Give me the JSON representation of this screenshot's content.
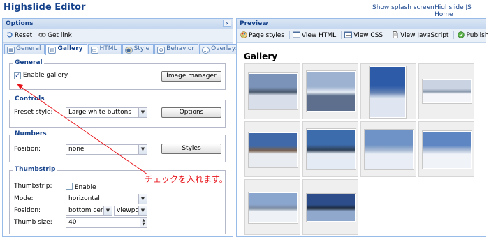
{
  "app": {
    "title": "Highslide Editor",
    "links": [
      "Show splash screen",
      "Highslide JS Home"
    ]
  },
  "options": {
    "header": "Options",
    "collapse_glyph": "«",
    "toolbar": {
      "reset": "Reset",
      "get_link": "Get link"
    },
    "tabs": [
      "General",
      "Gallery",
      "HTML",
      "Style",
      "Behavior",
      "Overlays"
    ],
    "active_tab": "Gallery",
    "general": {
      "legend": "General",
      "enable_gallery_label": "Enable gallery",
      "enable_gallery_checked": true,
      "image_manager_button": "Image manager"
    },
    "controls": {
      "legend": "Controls",
      "preset_label": "Preset style:",
      "preset_value": "Large white buttons",
      "options_button": "Options"
    },
    "numbers": {
      "legend": "Numbers",
      "position_label": "Position:",
      "position_value": "none",
      "styles_button": "Styles"
    },
    "thumbstrip": {
      "legend": "Thumbstrip",
      "thumbstrip_label": "Thumbstrip:",
      "enable_label": "Enable",
      "enable_checked": false,
      "mode_label": "Mode:",
      "mode_value": "horizontal",
      "position_label": "Position:",
      "position_value_1": "bottom cente",
      "position_value_2": "viewpo",
      "thumb_size_label": "Thumb size:",
      "thumb_size_value": "40"
    }
  },
  "preview": {
    "header": "Preview",
    "toolbar": [
      "Page styles",
      "View HTML",
      "View CSS",
      "View JavaScript",
      "Publish"
    ],
    "gallery_title": "Gallery",
    "thumbnails": [
      {
        "name": "snowy-valley-village",
        "colors": [
          "#7b93b8",
          "#d9dfea",
          "#4a5a6e"
        ]
      },
      {
        "name": "sun-through-clouds-lake",
        "colors": [
          "#9db2d0",
          "#5d6f8c",
          "#e6ecf5"
        ]
      },
      {
        "name": "snow-slope-blue-sky",
        "colors": [
          "#2d5ba8",
          "#dfe6f2",
          "#6a86b5"
        ]
      },
      {
        "name": "misty-mountain-ridge",
        "colors": [
          "#c9d3e1",
          "#f3f5f9",
          "#8a99ad"
        ]
      },
      {
        "name": "cabin-in-snow",
        "colors": [
          "#3f69a9",
          "#e8ebf0",
          "#7a6250"
        ]
      },
      {
        "name": "fjord-mountains",
        "colors": [
          "#3d6cad",
          "#e5ebf4",
          "#2f4259"
        ]
      },
      {
        "name": "snow-plateau-horizon",
        "colors": [
          "#6f93c6",
          "#e9eef6",
          "#a9bad3"
        ]
      },
      {
        "name": "snowfield-sky",
        "colors": [
          "#5e86c2",
          "#f0f3f8",
          "#b6c4d9"
        ]
      },
      {
        "name": "snowy-ridge-tent",
        "colors": [
          "#8aa6cf",
          "#eef1f6",
          "#7a8aa0"
        ]
      },
      {
        "name": "lake-mountain-shore",
        "colors": [
          "#2c4d8a",
          "#8fa8cc",
          "#1d2838"
        ]
      }
    ]
  },
  "annotation": "チェックを入れます。",
  "colors": {
    "annotation_red": "#e8141b",
    "panel_border": "#99bbe8",
    "header_text": "#15428b"
  }
}
